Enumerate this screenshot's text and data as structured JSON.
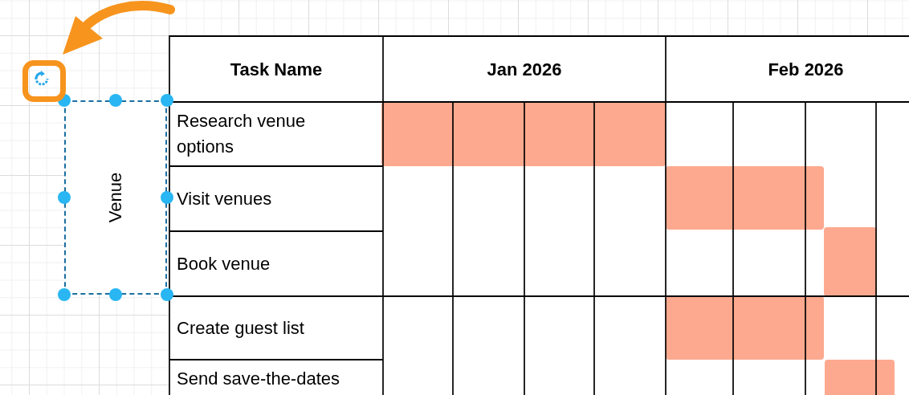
{
  "table": {
    "columns": [
      {
        "label": "Task Name"
      },
      {
        "label": "Jan 2026"
      },
      {
        "label": "Feb 2026"
      }
    ],
    "rows": [
      {
        "task": "Research venue options"
      },
      {
        "task": "Visit venues"
      },
      {
        "task": "Book venue"
      },
      {
        "task": "Create guest list"
      },
      {
        "task": "Send save-the-dates"
      }
    ]
  },
  "groups": [
    {
      "label": "Venue",
      "selected": true
    }
  ]
}
